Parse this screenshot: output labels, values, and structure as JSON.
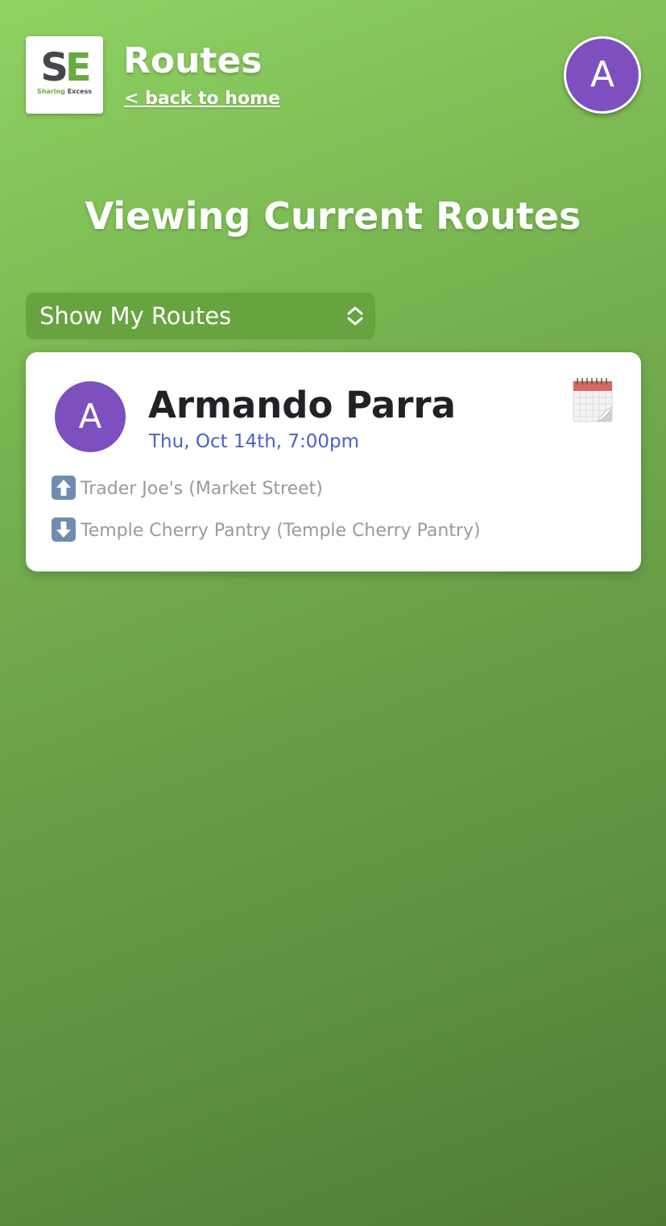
{
  "header": {
    "logo": {
      "letter_s": "S",
      "letter_e": "E",
      "subtitle_a": "Sharing",
      "subtitle_b": "Excess"
    },
    "title": "Routes",
    "back_link": "< back to home",
    "avatar_initial": "A"
  },
  "page_heading": "Viewing Current Routes",
  "filter": {
    "selected": "Show My Routes",
    "icon": "chevron-up-down-icon"
  },
  "route_card": {
    "avatar_initial": "A",
    "driver_name": "Armando Parra",
    "date": "Thu, Oct 14th, 7:00pm",
    "calendar_icon": "calendar-icon",
    "pickup": {
      "icon": "up-arrow-icon",
      "label": "Trader Joe's (Market Street)"
    },
    "dropoff": {
      "icon": "down-arrow-icon",
      "label": "Temple Cherry Pantry (Temple Cherry Pantry)"
    }
  },
  "colors": {
    "avatar_purple": "#7e4fbe",
    "date_blue": "#4c62c2",
    "brand_green": "#6aa842",
    "stop_gray": "#9a9a9e"
  }
}
